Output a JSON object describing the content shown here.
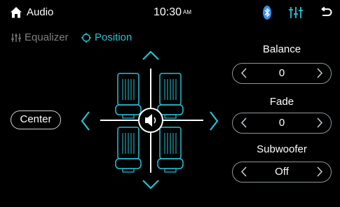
{
  "status_bar": {
    "title": "Audio",
    "time": "10:30",
    "time_suffix": "AM"
  },
  "tabs": [
    {
      "label": "Equalizer",
      "icon": "equalizer-icon",
      "active": false
    },
    {
      "label": "Position",
      "icon": "position-icon",
      "active": true
    }
  ],
  "center_button": "Center",
  "balance": {
    "label": "Balance",
    "value": "0"
  },
  "fade": {
    "label": "Fade",
    "value": "0"
  },
  "subwoofer": {
    "label": "Subwoofer",
    "value": "Off"
  },
  "colors": {
    "accent": "#25c2d6",
    "bluetooth": "#3a8fe8",
    "background": "#000000",
    "inactive_text": "#7f7f7f"
  }
}
